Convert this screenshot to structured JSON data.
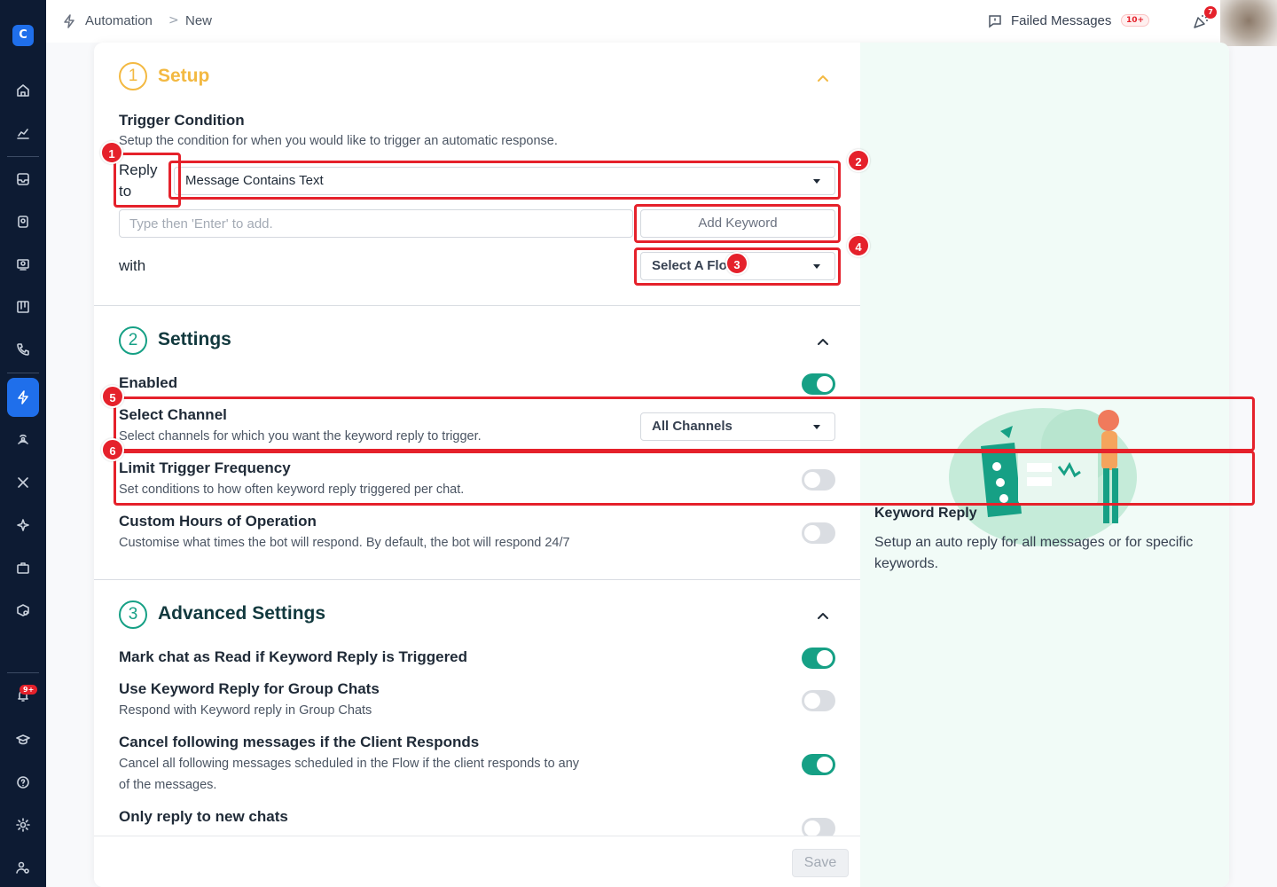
{
  "breadcrumb": {
    "root": "Automation",
    "separator": ">",
    "current": "New"
  },
  "topbar": {
    "failed_label": "Failed Messages",
    "failed_badge": "10+",
    "notif_badge": "7"
  },
  "sidebar": {
    "badge": "9+"
  },
  "setup": {
    "step": "1",
    "title": "Setup",
    "trigger_title": "Trigger Condition",
    "trigger_desc": "Setup the condition for when you would like to trigger an automatic response.",
    "reply_label_1": "Reply",
    "reply_label_2": "to",
    "reply_select": "Message Contains Text",
    "keyword_placeholder": "Type then 'Enter' to add.",
    "add_keyword": "Add Keyword",
    "with_label": "with",
    "flow_select": "Select A Flo"
  },
  "settings": {
    "step": "2",
    "title": "Settings",
    "enabled_label": "Enabled",
    "enabled": true,
    "channel_title": "Select Channel",
    "channel_desc": "Select channels for which you want the keyword reply to trigger.",
    "channel_select": "All Channels",
    "limit_title": "Limit Trigger Frequency",
    "limit_desc": "Set conditions to how often keyword reply triggered per chat.",
    "limit_enabled": false,
    "hours_title": "Custom Hours of Operation",
    "hours_desc": "Customise what times the bot will respond. By default, the bot will respond 24/7",
    "hours_enabled": false
  },
  "advanced": {
    "step": "3",
    "title": "Advanced Settings",
    "mark_read_title": "Mark chat as Read if Keyword Reply is Triggered",
    "mark_read_enabled": true,
    "group_title": "Use Keyword Reply for Group Chats",
    "group_desc": "Respond with Keyword reply in Group Chats",
    "group_enabled": false,
    "cancel_title": "Cancel following messages if the Client Responds",
    "cancel_desc_1": "Cancel all following messages scheduled in the Flow if the client responds to any",
    "cancel_desc_2": "of the messages.",
    "cancel_enabled": true,
    "new_chats_title": "Only reply to new chats"
  },
  "footer": {
    "save": "Save"
  },
  "info_panel": {
    "title": "Keyword Reply",
    "desc": "Setup an auto reply for all messages or for specific keywords."
  },
  "annotations": [
    "1",
    "2",
    "3",
    "4",
    "5",
    "6"
  ],
  "colors": {
    "accent": "#16a085",
    "setup_accent": "#f3b942",
    "sidebar": "#0d1b33",
    "active_nav": "#1f6feb",
    "annotation": "#e5212b"
  }
}
